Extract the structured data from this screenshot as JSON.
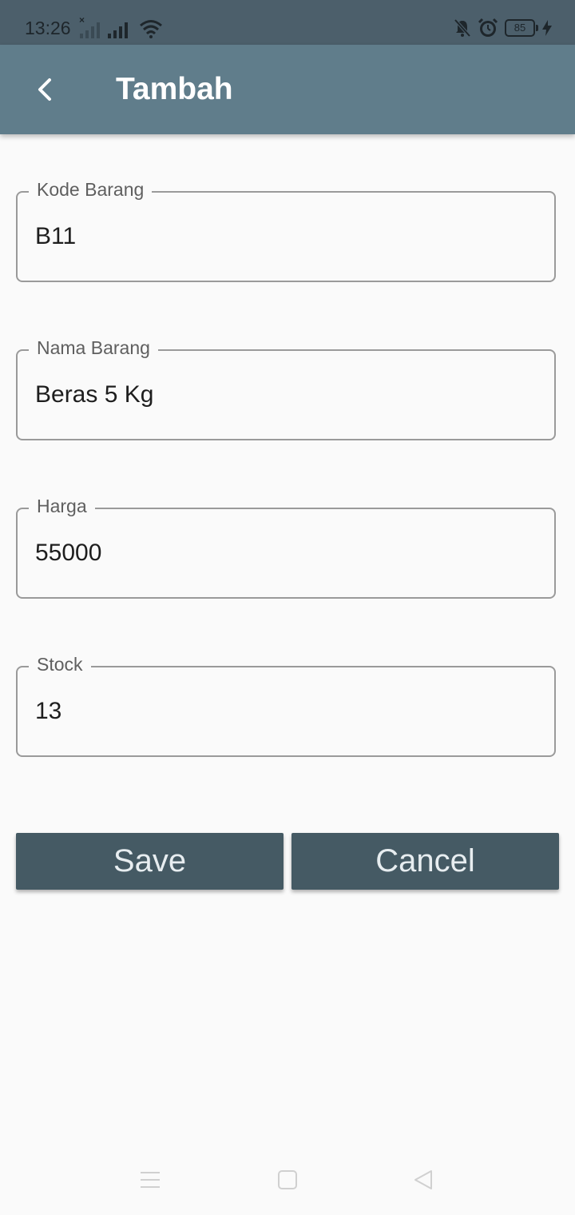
{
  "status_bar": {
    "time": "13:26",
    "battery_level": "85"
  },
  "app_bar": {
    "title": "Tambah"
  },
  "form": {
    "fields": [
      {
        "label": "Kode Barang",
        "value": "B11"
      },
      {
        "label": "Nama Barang",
        "value": "Beras 5 Kg"
      },
      {
        "label": "Harga",
        "value": "55000"
      },
      {
        "label": "Stock",
        "value": "13"
      }
    ]
  },
  "buttons": {
    "save_label": "Save",
    "cancel_label": "Cancel"
  },
  "colors": {
    "status_bar": "#4c5f6b",
    "app_bar": "#607d8b",
    "button": "#455a64",
    "background": "#fafafa"
  },
  "icons": {
    "back": "back-arrow-icon",
    "nav_menu": "menu-lines-icon",
    "nav_home": "home-square-icon",
    "nav_back": "back-triangle-icon"
  }
}
